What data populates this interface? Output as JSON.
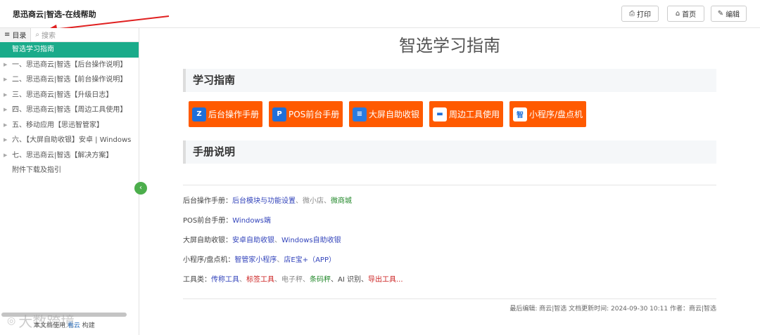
{
  "header": {
    "title": "思迅商云|智选-在线帮助",
    "print_label": "打印",
    "home_label": "首页",
    "edit_label": "编辑"
  },
  "sidebar": {
    "toc_label": "目录",
    "search_placeholder": "搜索",
    "items": [
      {
        "label": "智选学习指南",
        "caret": false,
        "active": true
      },
      {
        "label": "一、思迅商云|智选【后台操作说明】",
        "caret": true
      },
      {
        "label": "二、思迅商云|智选【前台操作说明】",
        "caret": true
      },
      {
        "label": "三、思迅商云|智选【升级日志】",
        "caret": true
      },
      {
        "label": "四、思迅商云|智选【周边工具使用】",
        "caret": true
      },
      {
        "label": "五、移动应用【思迅智管家】",
        "caret": true
      },
      {
        "label": "六、【大屏自助收银】安卓 | Windows",
        "caret": true
      },
      {
        "label": "七、思迅商云|智选【解决方案】",
        "caret": true
      },
      {
        "label": "附件下载及指引",
        "caret": false
      }
    ],
    "footer_prefix": "本文档使用",
    "footer_link": "看云",
    "footer_suffix": "构建",
    "watermark": "大数跨境"
  },
  "main": {
    "page_title": "智选学习指南",
    "section1": "学习指南",
    "section2": "手册说明",
    "buttons": [
      {
        "label": "后台操作手册",
        "icon": "Z",
        "icon_name": "backend-icon",
        "icon_bg": "#1e6fd9",
        "icon_fg": "#fff"
      },
      {
        "label": "POS前台手册",
        "icon": "P",
        "icon_name": "pos-icon",
        "icon_bg": "#1e6fd9",
        "icon_fg": "#fff"
      },
      {
        "label": "大屏自助收银",
        "icon": "≡",
        "icon_name": "kiosk-icon",
        "icon_bg": "#2a7be0",
        "icon_fg": "#fff"
      },
      {
        "label": "周边工具使用",
        "icon": "▬",
        "icon_name": "tools-icon",
        "icon_bg": "#ffffff",
        "icon_fg": "#1e6fd9"
      },
      {
        "label": "小程序/盘点机",
        "icon": "智",
        "icon_name": "miniprogram-icon",
        "icon_bg": "#ffffff",
        "icon_fg": "#1e6fd9"
      }
    ],
    "lines": [
      {
        "prefix": "后台操作手册：",
        "parts": [
          {
            "t": "后台模块与功能设置",
            "c": "blue"
          },
          {
            "t": "、",
            "c": "gray"
          },
          {
            "t": "微小店",
            "c": "gray"
          },
          {
            "t": "、",
            "c": "gray"
          },
          {
            "t": "微商城",
            "c": "green"
          }
        ]
      },
      {
        "prefix": "POS前台手册：",
        "parts": [
          {
            "t": "Windows端",
            "c": "blue"
          }
        ]
      },
      {
        "prefix": "大屏自助收银：",
        "parts": [
          {
            "t": "安卓自助收银",
            "c": "blue"
          },
          {
            "t": "、",
            "c": "gray"
          },
          {
            "t": "Windows自助收银",
            "c": "blue"
          }
        ]
      },
      {
        "prefix": "小程序/盘点机：",
        "parts": [
          {
            "t": "智管家小程序",
            "c": "blue"
          },
          {
            "t": "、",
            "c": "gray"
          },
          {
            "t": "店E宝+（APP）",
            "c": "blue"
          }
        ]
      },
      {
        "prefix": "工具类：",
        "parts": [
          {
            "t": "传称工具",
            "c": "blue"
          },
          {
            "t": "、",
            "c": "gray"
          },
          {
            "t": "标签工具",
            "c": "red"
          },
          {
            "t": "、电子秤、",
            "c": "gray"
          },
          {
            "t": "条码秤",
            "c": "green"
          },
          {
            "t": "、AI 识别、",
            "c": "plain"
          },
          {
            "t": "导出工具...",
            "c": "red"
          }
        ]
      }
    ],
    "meta": "最后编辑: 商云|智选  文档更新时间: 2024-09-30 10:11   作者：商云|智选"
  }
}
